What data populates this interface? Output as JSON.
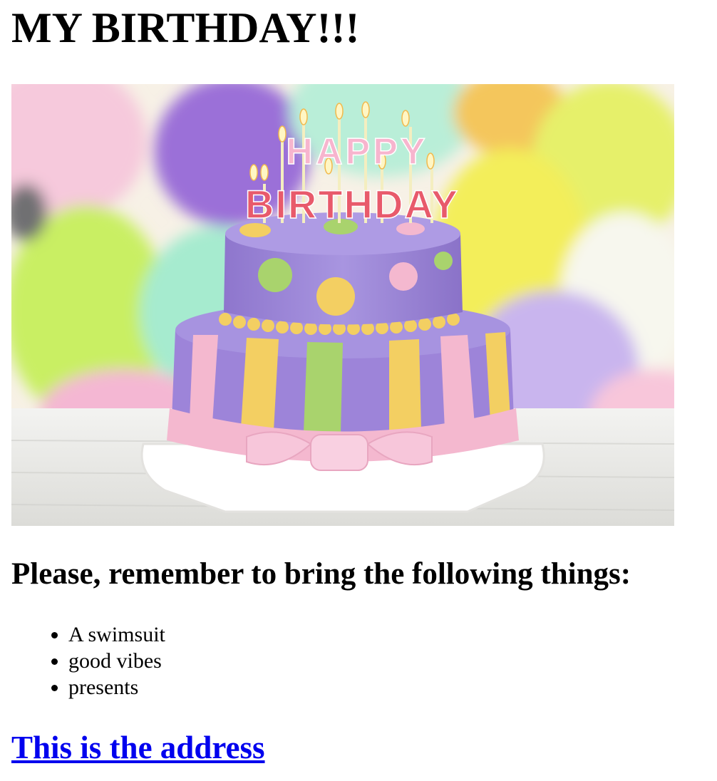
{
  "page": {
    "title": "MY BIRTHDAY!!!",
    "subtitle": "Please, remember to bring the following things:",
    "things": [
      "A swimsuit",
      "good vibes",
      "presents"
    ],
    "address_link": "This is the address"
  },
  "photo": {
    "topper_line1": "HAPPY",
    "topper_line2": "BIRTHDAY",
    "colors": {
      "balloon_yellow": "#f3ee5a",
      "balloon_lime": "#c9ef63",
      "balloon_purple": "#9b6fd8",
      "balloon_pink": "#f4b7d3",
      "balloon_mint": "#a6ebcf",
      "cake_purple": "#9d84d9",
      "cake_pink": "#f4b8cf",
      "cake_yellow": "#f3cf62",
      "cake_green": "#a9d36d",
      "link_blue": "#0000ee"
    }
  }
}
